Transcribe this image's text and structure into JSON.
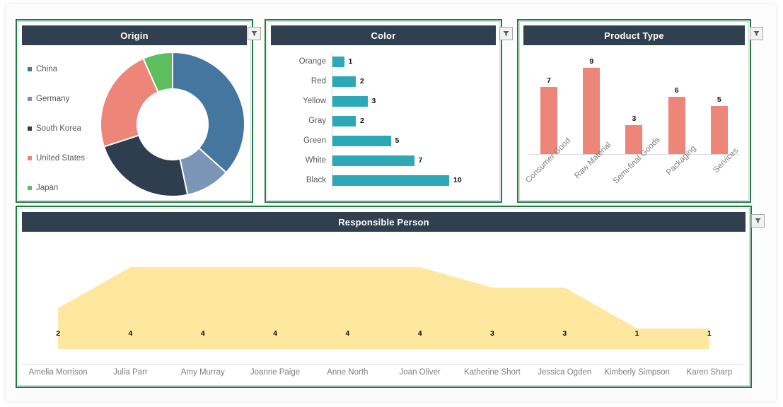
{
  "colors": {
    "header_bg": "#30404f",
    "selection_green": "#1f7a45",
    "teal": "#2CA8B6",
    "coral": "#ED8679",
    "amber_area": "#FFE7A0",
    "donut_china": "#4576A0",
    "donut_germany": "#7B95B6",
    "donut_south_korea": "#2F3D50",
    "donut_united_states": "#ED8679",
    "donut_japan": "#5CBE5C"
  },
  "panels": {
    "origin": {
      "title": "Origin",
      "filter_icon": "filter-dropdown-icon"
    },
    "color": {
      "title": "Color",
      "filter_icon": "filter-dropdown-icon"
    },
    "product_type": {
      "title": "Product Type",
      "filter_icon": "filter-dropdown-icon"
    },
    "responsible_person": {
      "title": "Responsible Person",
      "filter_icon": "filter-dropdown-icon"
    }
  },
  "chart_data": [
    {
      "type": "pie",
      "title": "Origin",
      "variant": "donut",
      "legend_position": "left",
      "categories": [
        "China",
        "Germany",
        "South Korea",
        "United States",
        "Japan"
      ],
      "values": [
        11,
        3,
        7,
        7,
        2
      ],
      "colors": [
        "#4576A0",
        "#7B95B6",
        "#2F3D50",
        "#ED8679",
        "#5CBE5C"
      ]
    },
    {
      "type": "bar",
      "orientation": "horizontal",
      "title": "Color",
      "xlabel": "",
      "ylabel": "",
      "grid": false,
      "categories": [
        "Orange",
        "Red",
        "Yellow",
        "Gray",
        "Green",
        "White",
        "Black"
      ],
      "values": [
        1,
        2,
        3,
        2,
        5,
        7,
        10
      ],
      "xlim": [
        0,
        10
      ],
      "series_color": "#2CA8B6",
      "data_labels": true
    },
    {
      "type": "bar",
      "orientation": "vertical",
      "title": "Product Type",
      "xlabel": "",
      "ylabel": "",
      "grid": false,
      "categories": [
        "Consumer Good",
        "Raw Material",
        "Semi-final Goods",
        "Packaging",
        "Services"
      ],
      "values": [
        7,
        9,
        3,
        6,
        5
      ],
      "ylim": [
        0,
        9
      ],
      "series_color": "#ED8679",
      "data_labels": true
    },
    {
      "type": "area",
      "title": "Responsible Person",
      "xlabel": "",
      "ylabel": "",
      "grid": false,
      "categories": [
        "Amelia Morrison",
        "Julia Parr",
        "Amy Murray",
        "Joanne Paige",
        "Anne North",
        "Joan Oliver",
        "Katherine Short",
        "Jessica Ogden",
        "Kimberly Simpson",
        "Karen Sharp"
      ],
      "values": [
        2,
        4,
        4,
        4,
        4,
        4,
        3,
        3,
        1,
        1
      ],
      "ylim": [
        0,
        5
      ],
      "series_color": "#FFE7A0",
      "data_labels": true
    }
  ]
}
